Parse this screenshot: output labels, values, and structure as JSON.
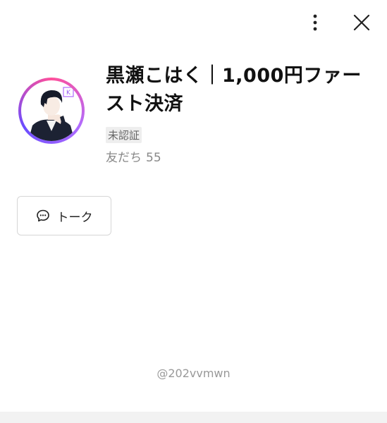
{
  "header": {
    "more_icon": "more-vertical-icon",
    "close_icon": "close-icon"
  },
  "profile": {
    "name": "黒瀬こはく｜1,000円ファースト決済",
    "verification_badge": "未認証",
    "friends_label": "友だち",
    "friends_count": "55",
    "avatar_logo_text": "K"
  },
  "actions": {
    "talk_label": "トーク",
    "talk_icon": "chat-bubble-icon"
  },
  "footer": {
    "account_id": "@202vvmwn"
  }
}
